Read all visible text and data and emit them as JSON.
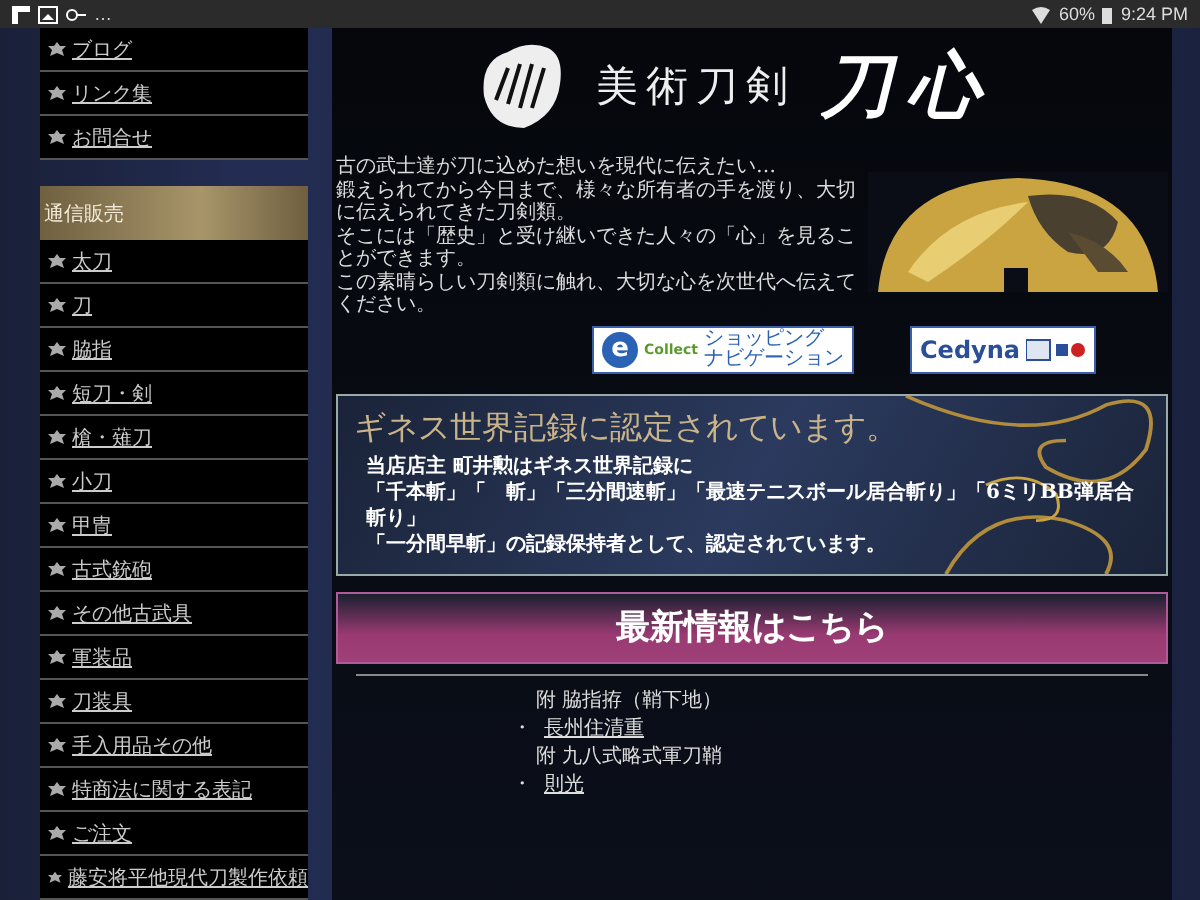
{
  "status_bar": {
    "more": "…",
    "battery": "60%",
    "time": "9:24 PM"
  },
  "sidebar": {
    "top_items": [
      "ブログ",
      "リンク集",
      "お問合せ"
    ],
    "section_title": "通信販売",
    "items": [
      "太刀",
      "刀",
      "脇指",
      "短刀・剣",
      "槍・薙刀",
      "小刀",
      "甲冑",
      "古式銃砲",
      "その他古武具",
      "軍装品",
      "刀装具",
      "手入用品その他",
      "特商法に関する表記",
      "ご注文",
      "藤安将平他現代刀製作依頼"
    ]
  },
  "header": {
    "brand": "美術刀剣",
    "name": "刀心"
  },
  "intro": {
    "lines": [
      "古の武士達が刀に込めた想いを現代に伝えたい…",
      "鍛えられてから今日まで、様々な所有者の手を渡り、大切に伝えられてきた刀剣類。",
      "そこには「歴史」と受け継いできた人々の「心」を見ることができます。",
      "この素晴らしい刀剣類に触れ、大切な心を次世代へ伝えてください。"
    ]
  },
  "badges": {
    "ecollect": {
      "mark": "e",
      "logo": "Collect",
      "line1": "ショッピング",
      "line2": "ナビゲーション"
    },
    "cedyna": {
      "logo": "Cedyna"
    }
  },
  "guinness": {
    "title": "ギネス世界記録に認定されています。",
    "lines": [
      "当店店主 町井勲はギネス世界記録に",
      "「千本斬」「　斬」「三分間速斬」「最速テニスボール居合斬り」「6ミリBB弾居合斬り」",
      "「一分間早斬」の記録保持者として、認定されています。"
    ]
  },
  "news": {
    "title": "最新情報はこちら",
    "items": [
      {
        "kind": "note",
        "text": "附 脇指拵（鞘下地）"
      },
      {
        "kind": "link",
        "bullet": "・",
        "text": "長州住清重"
      },
      {
        "kind": "note",
        "text": "附 九八式略式軍刀鞘"
      },
      {
        "kind": "link",
        "bullet": "・",
        "text": "則光"
      }
    ]
  }
}
